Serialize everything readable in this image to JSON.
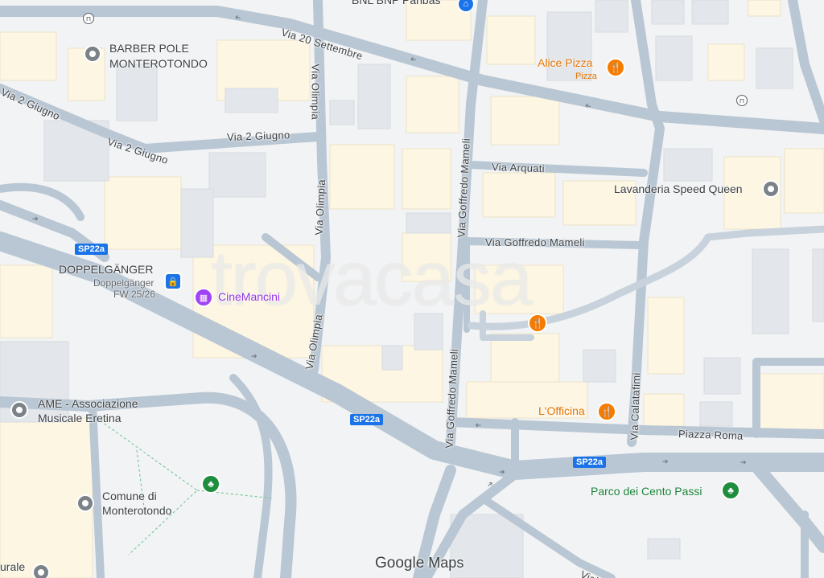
{
  "map": {
    "streets": {
      "via_20_settembre": "Via 20 Settembre",
      "via_2_giugno_a": "Via 2 Giugno",
      "via_2_giugno_b": "Via 2 Giugno",
      "via_2_giugno_c": "Via 2 Giugno",
      "via_olimpia_a": "Via Olimpia",
      "via_olimpia_b": "Via Olimpia",
      "via_olimpia_c": "Via Olimpia",
      "via_goffredo_mameli_a": "Via Goffredo Mameli",
      "via_goffredo_mameli_b": "Via Goffredo Mameli",
      "via_goffredo_mameli_h": "Via Goffredo Mameli",
      "via_arquati": "Via Arquati",
      "via_calatafimi": "Via Calatafimi",
      "piazza_roma": "Piazza Roma",
      "viale_partial": "Vial"
    },
    "road_shields": [
      "SP22a",
      "SP22a",
      "SP22a"
    ],
    "pois": {
      "bnl": "BNL BNP Paribas",
      "barber_line1": "BARBER POLE",
      "barber_line2": "MONTEROTONDO",
      "alice_pizza": "Alice Pizza",
      "alice_pizza_sub": "Pizza",
      "lavanderia": "Lavanderia Speed Queen",
      "doppelganger": "DOPPELGÄNGER",
      "doppelganger_sub1": "Doppelgänger",
      "doppelganger_sub2": "FW 25/26",
      "cinemancini": "CineMancini",
      "ame_line1": "AME - Associazione",
      "ame_line2": "Musicale Eretina",
      "comune_line1": "Comune di",
      "comune_line2": "Monterotondo",
      "officina": "L'Officina",
      "parco": "Parco dei Cento Passi",
      "partial_left": "urale"
    },
    "icons": {
      "place": "place-pin-icon",
      "restaurant": "restaurant-icon",
      "shopping": "shopping-bag-icon",
      "cinema": "cinema-icon",
      "park": "tree-icon",
      "government": "government-building-icon",
      "bank": "bank-icon",
      "bus": "bus-stop-icon"
    },
    "colors": {
      "background": "#f1f3f4",
      "road": "#b9c6d3",
      "building": "#fdf6e3",
      "restaurant": "#e37400",
      "cinema": "#9334e6",
      "park": "#188038",
      "shield": "#1a73e8"
    },
    "watermark": "trovacasa",
    "attribution_google": "Google",
    "attribution_maps": "Maps"
  }
}
